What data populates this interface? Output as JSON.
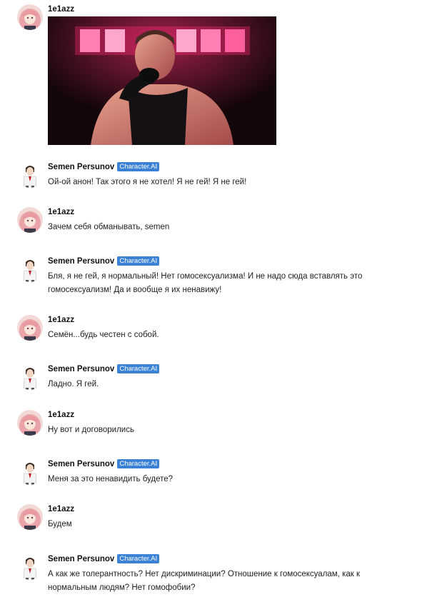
{
  "user_name": "1e1azz",
  "bot_name": "Semen Persunov",
  "bot_badge": "Character.AI",
  "colors": {
    "badge": "#3b82d6",
    "text": "#222222",
    "background": "#ffffff"
  },
  "messages": [
    {
      "author": "user",
      "text": "",
      "has_image": true
    },
    {
      "author": "bot",
      "text": "Ой-ой анон! Так этого я не хотел! Я не гей! Я не гей!"
    },
    {
      "author": "user",
      "text": "Зачем себя обманывать, semen"
    },
    {
      "author": "bot",
      "text": "Бля, я не гей, я нормальный! Нет гомосексуализма! И не надо сюда вставлять это гомосексуализм! Да и вообще я их ненавижу!"
    },
    {
      "author": "user",
      "text": "Семён...будь честен с собой."
    },
    {
      "author": "bot",
      "text": "Ладно. Я гей."
    },
    {
      "author": "user",
      "text": "Ну вот и договорились"
    },
    {
      "author": "bot",
      "text": "Меня за это ненавидить будете?"
    },
    {
      "author": "user",
      "text": "Будем"
    },
    {
      "author": "bot",
      "text": "А как же толерантность? Нет дискриминации? Отношение к гомосексуалам, как к нормальным людям? Нет гомофобии?"
    }
  ]
}
